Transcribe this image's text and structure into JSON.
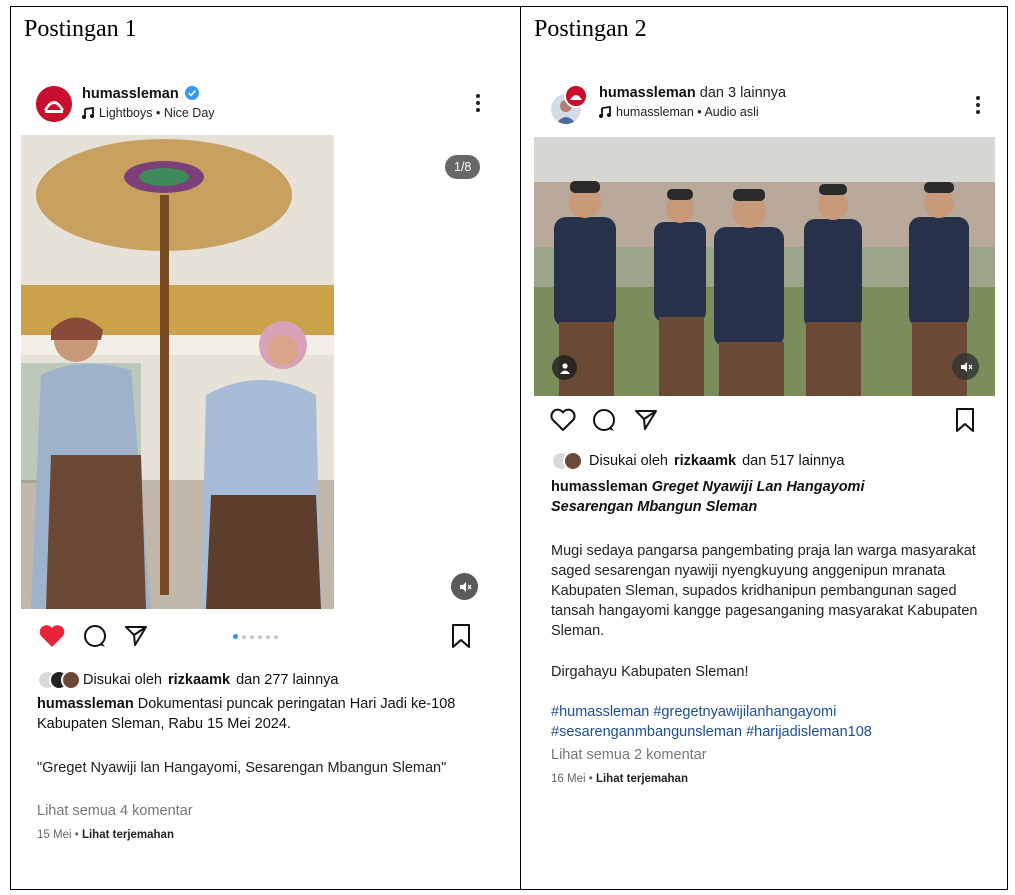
{
  "cells": [
    {
      "title": "Postingan 1",
      "username": "humassleman",
      "username_suffix": "",
      "audio": "Lightboys • Nice Day",
      "counter": "1/8",
      "likes_prefix": "Disukai oleh",
      "likes_user": "rizkaamk",
      "likes_suffix": "dan 277 lainnya",
      "caption_user": "humassleman",
      "caption_text": "Dokumentasi puncak peringatan Hari Jadi ke-108 Kabupaten Sleman, Rabu 15 Mei 2024.",
      "quote": "\"Greget Nyawiji lan Hangayomi, Sesarengan Mbangun Sleman\"",
      "comments_link": "Lihat semua 4 komentar",
      "date": "15 Mei",
      "translate": "Lihat terjemahan",
      "liked": true
    },
    {
      "title": "Postingan 2",
      "username": "humassleman",
      "username_suffix": "dan 3 lainnya",
      "audio": "humassleman • Audio asli",
      "likes_prefix": "Disukai oleh",
      "likes_user": "rizkaamk",
      "likes_suffix": "dan 517 lainnya",
      "caption_user": "humassleman",
      "caption_title": "Greget Nyawiji Lan Hangayomi Sesarengan Mbangun Sleman",
      "para1": "Mugi sedaya pangarsa pangembating praja lan warga masyarakat saged sesarengan nyawiji nyengkuyung anggenipun mranata Kabupaten Sleman, supados kridhanipun pembangunan saged tansah hangayomi kangge pagesanganing masyarakat Kabupaten Sleman.",
      "para2": "Dirgahayu Kabupaten Sleman!",
      "hashtags": "#humassleman #gregetnyawijilanhangayomi #sesarenganmbangunsleman #harijadisleman108",
      "comments_link": "Lihat semua 2 komentar",
      "date": "16 Mei",
      "translate": "Lihat terjemahan",
      "liked": false
    }
  ],
  "colors": {
    "heart": "#e8243c",
    "verified": "#3897f0",
    "hashtag": "#1d4e8f",
    "brand_red": "#c8102e"
  },
  "icons": [
    "heart-icon",
    "comment-icon",
    "share-icon",
    "bookmark-icon",
    "music-icon",
    "sound-icon",
    "kebab-icon",
    "verified-icon",
    "person-tag-icon"
  ]
}
